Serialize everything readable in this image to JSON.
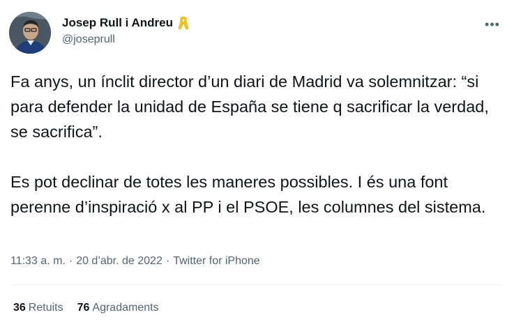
{
  "author": {
    "display_name": "Josep Rull i Andreu",
    "handle": "@joseprull",
    "badge_icon": "yellow-ribbon-icon",
    "badge_color": "#f5c518"
  },
  "menu": {
    "more_label": "•••"
  },
  "tweet": {
    "paragraphs": [
      "Fa anys, un ínclit director d’un diari de Madrid va solemnitzar: “si para defender la unidad de España se tiene q sacrificar la verdad, se sacrifica”.",
      "Es pot declinar de totes les maneres possibles. I és una font perenne d’inspiració x al PP i el PSOE, les columnes del sistema."
    ]
  },
  "meta": {
    "time": "11:33 a. m.",
    "separator": "·",
    "date": "20 d’abr. de 2022",
    "source": "Twitter for iPhone"
  },
  "stats": {
    "retweets_count": "36",
    "retweets_label": "Retuits",
    "likes_count": "76",
    "likes_label": "Agradaments"
  },
  "colors": {
    "text": "#0f1419",
    "secondary": "#536471",
    "divider": "#eff3f4"
  }
}
